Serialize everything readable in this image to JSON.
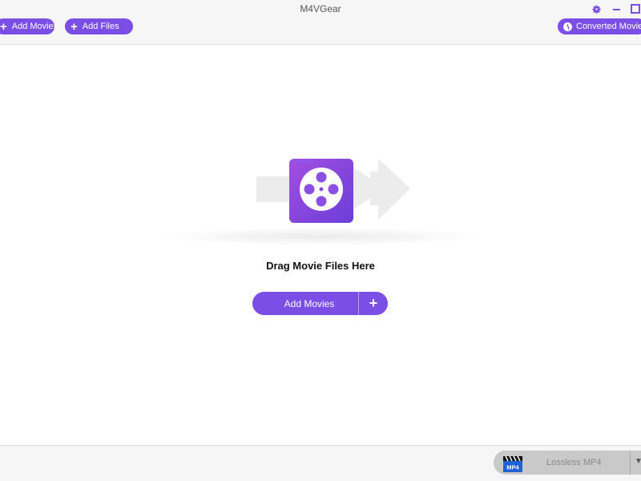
{
  "window": {
    "title": "M4VGear"
  },
  "toolbar": {
    "add_movies_label": "Add Movies",
    "add_files_label": "Add Files",
    "converted_label": "Converted Movies"
  },
  "main": {
    "drop_text": "Drag Movie Files Here",
    "add_movies_button_label": "Add Movies"
  },
  "output": {
    "format_label": "Lossless MP4",
    "format_badge": "MP4"
  },
  "icons": {
    "settings": "gear-icon",
    "minimize": "minimize-icon",
    "maximize": "maximize-icon",
    "add": "plus-icon",
    "history": "clock-icon",
    "film": "film-reel-icon",
    "dropdown": "chevron-down-icon"
  },
  "colors": {
    "accent": "#7b4ee6",
    "accent_gradient_start": "#a44de0",
    "accent_gradient_end": "#6a3fd9",
    "bar_background": "#f6f6f6",
    "format_select_bg": "#c9c9c9"
  }
}
